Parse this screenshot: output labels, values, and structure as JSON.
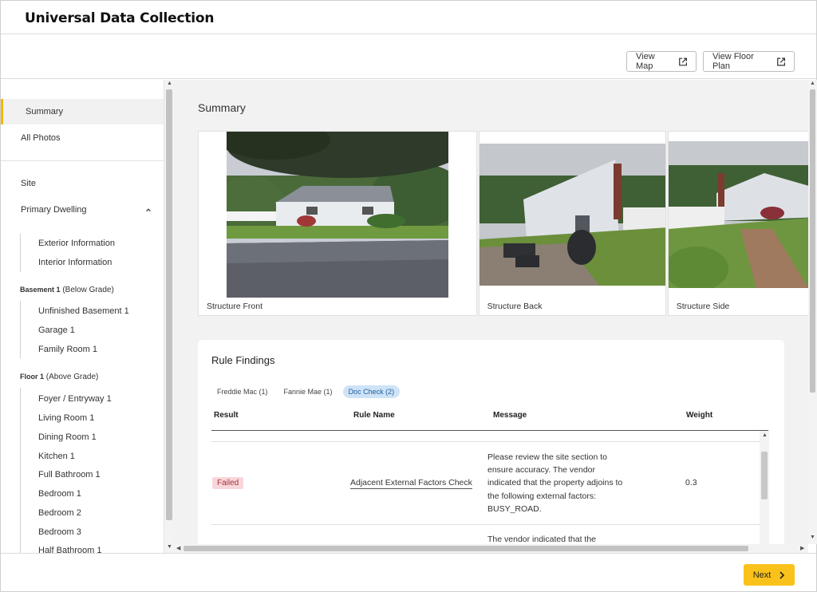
{
  "header": {
    "title": "Universal Data Collection"
  },
  "toolbar": {
    "view_map": "View Map",
    "view_floor_plan": "View Floor Plan"
  },
  "sidebar": {
    "summary": "Summary",
    "all_photos": "All Photos",
    "site": "Site",
    "primary_dwelling": "Primary Dwelling",
    "primary_children": [
      "Exterior Information",
      "Interior Information"
    ],
    "basement_group": {
      "name": "Basement 1",
      "grade": "(Below Grade)"
    },
    "basement_children": [
      "Unfinished Basement 1",
      "Garage 1",
      "Family Room 1"
    ],
    "floor_group": {
      "name": "Floor 1",
      "grade": "(Above Grade)"
    },
    "floor_children": [
      "Foyer / Entryway 1",
      "Living Room 1",
      "Dining Room 1",
      "Kitchen 1",
      "Full Bathroom 1",
      "Bedroom 1",
      "Bedroom 2",
      "Bedroom 3",
      "Half Bathroom 1"
    ]
  },
  "main": {
    "title": "Summary",
    "photos": [
      {
        "caption": "Structure Front"
      },
      {
        "caption": "Structure Back"
      },
      {
        "caption": "Structure Side"
      }
    ]
  },
  "rules": {
    "title": "Rule Findings",
    "tabs": [
      "Freddie Mac (1)",
      "Fannie Mae (1)",
      "Doc Check (2)"
    ],
    "columns": [
      "Result",
      "Rule Name",
      "Message",
      "Weight"
    ],
    "rows": [
      {
        "result": "Failed",
        "rule_name": "Adjacent External Factors Check",
        "message": "Please review the site section to ensure accuracy. The vendor indicated that the property adjoins to the following external factors: BUSY_ROAD.",
        "weight": "0.3"
      },
      {
        "message": "The vendor indicated that the"
      }
    ]
  },
  "footer": {
    "next": "Next"
  },
  "colors": {
    "accent": "#f9c21b",
    "active_border": "#f5b800",
    "failed_bg": "#f8d7da",
    "failed_text": "#a3323b",
    "tab_selected": "#cfe3f7"
  },
  "icons": {
    "external_link": "external-link-icon",
    "chevron_up": "chevron-up-icon",
    "chevron_right": "chevron-right-icon"
  }
}
